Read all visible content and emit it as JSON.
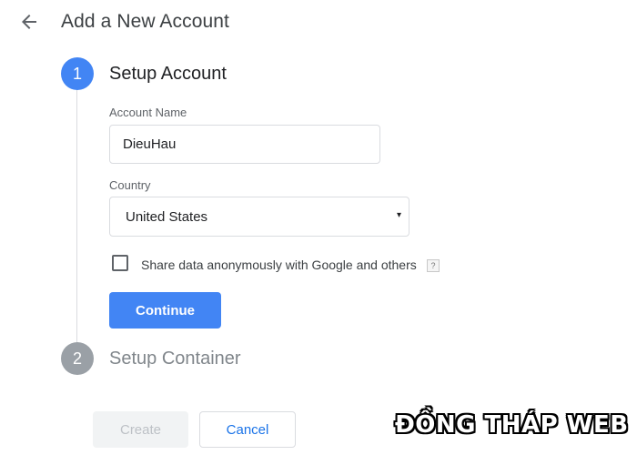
{
  "header": {
    "back_icon": "arrow-left-icon",
    "title": "Add a New Account"
  },
  "steps": [
    {
      "number": "1",
      "title": "Setup Account",
      "state": "active",
      "color": "#4285f4"
    },
    {
      "number": "2",
      "title": "Setup Container",
      "state": "inactive",
      "color": "#9aa0a6"
    }
  ],
  "form": {
    "account_name_label": "Account Name",
    "account_name_value": "DieuHau",
    "country_label": "Country",
    "country_value": "United States",
    "country_caret": "▾",
    "share_data_label": "Share data anonymously with Google and others",
    "share_data_checked": false,
    "help_badge": "?",
    "continue_label": "Continue"
  },
  "footer": {
    "create_label": "Create",
    "cancel_label": "Cancel"
  },
  "watermark": "ĐỒNG THÁP WEB",
  "colors": {
    "primary": "#4285f4",
    "link": "#1a73e8",
    "disabled_bg": "#f1f3f4",
    "disabled_text": "#bdc1c6",
    "border": "#dadce0"
  }
}
